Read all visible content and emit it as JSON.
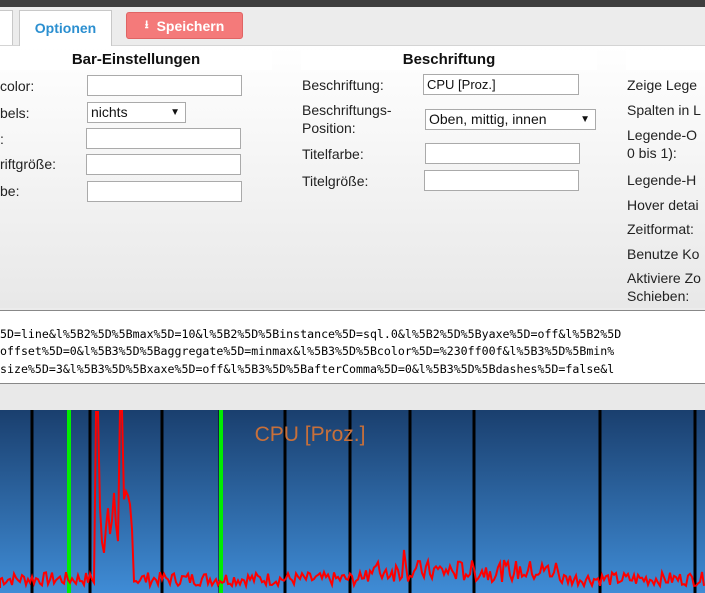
{
  "tabs": {
    "active_label": "Optionen"
  },
  "toolbar": {
    "save_label": "Speichern",
    "save_icon": "download-icon"
  },
  "sections": {
    "bar": {
      "title": "Bar-Einstellungen",
      "rows": [
        {
          "label": "color:",
          "value": ""
        },
        {
          "label": "bels:",
          "value": "nichts"
        },
        {
          "label": ":",
          "value": ""
        },
        {
          "label": "riftgröße:",
          "value": ""
        },
        {
          "label": "be:",
          "value": ""
        }
      ]
    },
    "beschriftung": {
      "title": "Beschriftung",
      "rows": [
        {
          "label": "Beschriftung:",
          "value": "CPU [Proz.]"
        },
        {
          "label_line1": "Beschriftungs-",
          "label_line2": "Position:",
          "value": "Oben, mittig, innen"
        },
        {
          "label": "Titelfarbe:",
          "value": ""
        },
        {
          "label": "Titelgröße:",
          "value": ""
        }
      ]
    },
    "legend": {
      "items": [
        "Zeige Lege",
        "Spalten in L",
        "Legende-O",
        "0 bis 1):",
        "Legende-H",
        "Hover detai",
        "Zeitformat:",
        "Benutze Ko",
        "Aktiviere Zo",
        "Schieben:"
      ]
    }
  },
  "url_box": {
    "lines": [
      "5D=line&l%5B2%5D%5Bmax%5D=10&l%5B2%5D%5Binstance%5D=sql.0&l%5B2%5D%5Byaxe%5D=off&l%5B2%5D",
      "offset%5D=0&l%5B3%5D%5Baggregate%5D=minmax&l%5B3%5D%5Bcolor%5D=%230ff00f&l%5B3%5D%5Bmin%",
      "size%5D=3&l%5B3%5D%5Bxaxe%5D=off&l%5B3%5D%5BafterComma%5D=0&l%5B3%5D%5Bdashes%5D=false&l"
    ]
  },
  "chart": {
    "title": "CPU [Proz.]",
    "title_color": "#c8703a",
    "line_color": "#ff0000",
    "marker_color": "#00ee00",
    "gradient_top": "#1a3f6e",
    "gradient_bottom": "#3f8cd6"
  }
}
